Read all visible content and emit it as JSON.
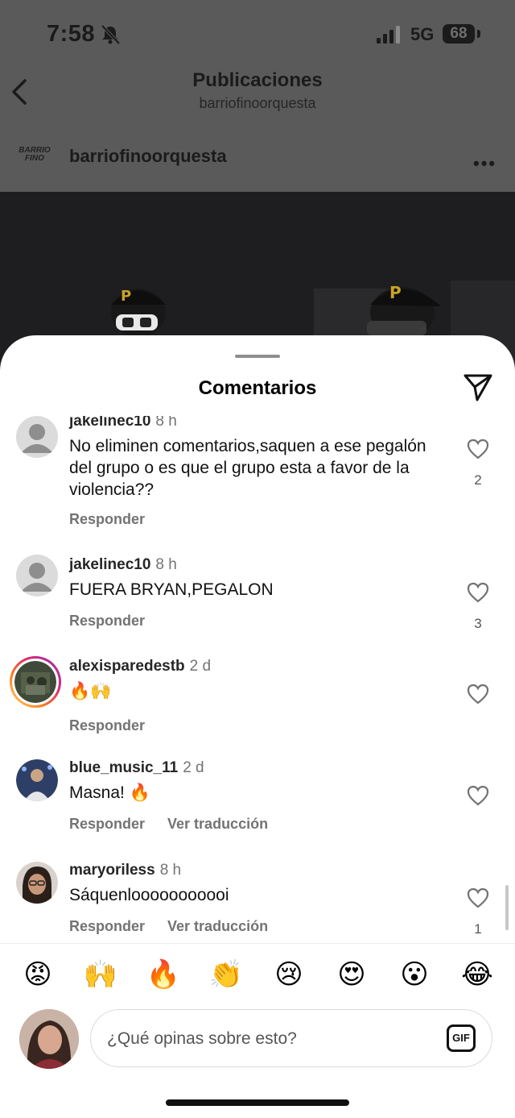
{
  "status_bar": {
    "time": "7:58",
    "network": "5G",
    "battery": "68"
  },
  "header": {
    "title": "Publicaciones",
    "subtitle": "barriofinoorquesta"
  },
  "post": {
    "username": "barriofinoorquesta",
    "logo_text": "BARRIO FINO"
  },
  "sheet": {
    "title": "Comentarios"
  },
  "comments": [
    {
      "username": "jakelinec10",
      "time": "8 h",
      "text": "No eliminen comentarios,saquen a ese pegalón del grupo o es que el grupo esta a favor de la violencia??",
      "reply": "Responder",
      "likes": "2"
    },
    {
      "username": "jakelinec10",
      "time": "8 h",
      "text": "FUERA BRYAN,PEGALON",
      "reply": "Responder",
      "likes": "3"
    },
    {
      "username": "alexisparedestb",
      "time": "2 d",
      "text": "🔥🙌",
      "reply": "Responder",
      "likes": ""
    },
    {
      "username": "blue_music_11",
      "time": "2 d",
      "text": "Masna! 🔥",
      "reply": "Responder",
      "translate": "Ver traducción",
      "likes": ""
    },
    {
      "username": "maryoriless",
      "time": "8 h",
      "text": "Sáquenlooooooooooi",
      "reply": "Responder",
      "translate": "Ver traducción",
      "likes": "1"
    }
  ],
  "reactions": [
    "😡",
    "🙌",
    "🔥",
    "👏",
    "😢",
    "😍",
    "😮",
    "😂"
  ],
  "composer": {
    "placeholder": "¿Qué opinas sobre esto?",
    "gif_label": "GIF"
  },
  "colors": {
    "story_ring_start": "#feda75",
    "story_ring_end": "#d62976",
    "text_secondary": "#737373"
  }
}
